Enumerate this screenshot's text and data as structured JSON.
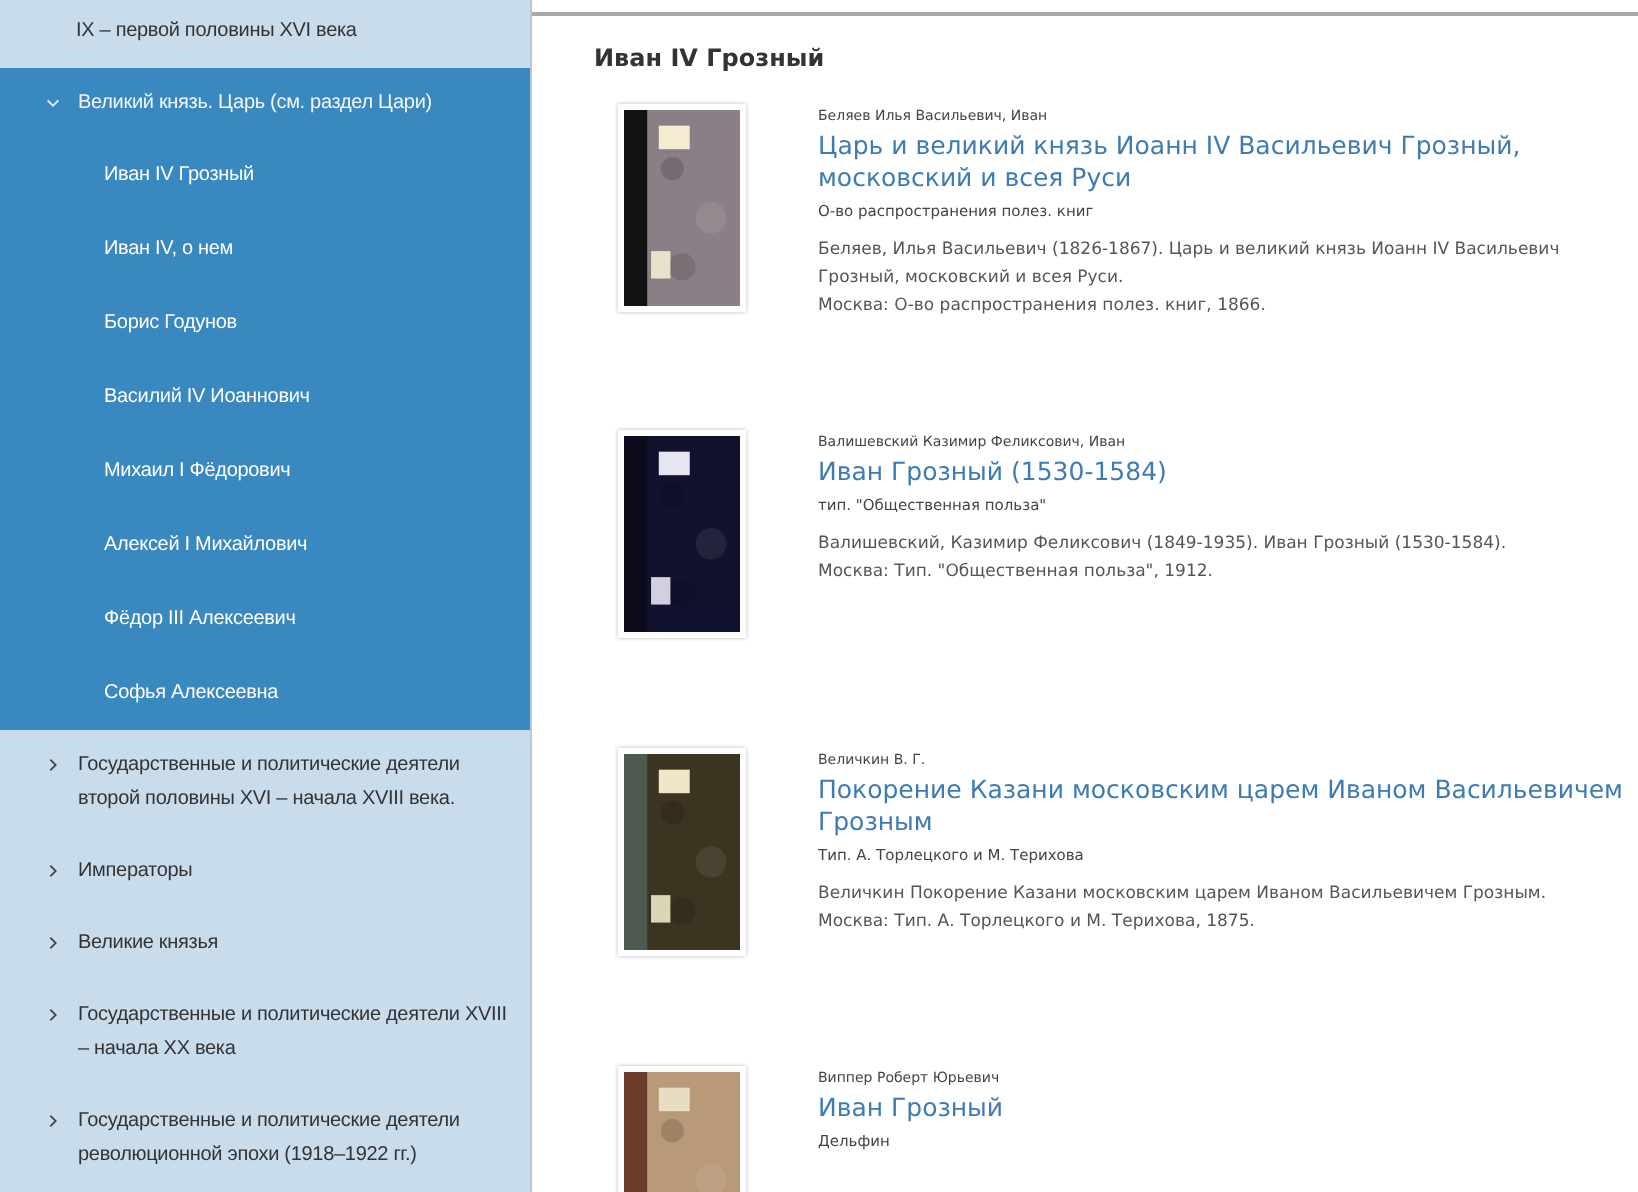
{
  "sidebar": {
    "items": [
      {
        "label": "IX – первой половины XVI века",
        "expanded": false,
        "has_chevron": false
      },
      {
        "label": "Великий князь. Царь (см. раздел Цари)",
        "expanded": true,
        "has_chevron": true,
        "children": [
          {
            "label": "Иван IV Грозный"
          },
          {
            "label": "Иван IV, о нем"
          },
          {
            "label": "Борис Годунов"
          },
          {
            "label": "Василий IV Иоаннович"
          },
          {
            "label": "Михаил I Фёдорович"
          },
          {
            "label": "Алексей I Михайлович"
          },
          {
            "label": "Фёдор III Алексеевич"
          },
          {
            "label": "Софья Алексеевна"
          }
        ]
      },
      {
        "label": "Государственные и политические деятели второй половины XVI – начала XVIII века.",
        "expanded": false,
        "has_chevron": true
      },
      {
        "label": "Императоры",
        "expanded": false,
        "has_chevron": true
      },
      {
        "label": "Великие князья",
        "expanded": false,
        "has_chevron": true
      },
      {
        "label": "Государственные и политические деятели XVIII – начала XX века",
        "expanded": false,
        "has_chevron": true
      },
      {
        "label": "Государственные и политические деятели революционной эпохи (1918–1922 гг.)",
        "expanded": false,
        "has_chevron": true
      }
    ]
  },
  "page_title": "Иван IV Грозный",
  "books": [
    {
      "author": "Беляев Илья Васильевич, Иван",
      "title": "Царь и великий князь Иоанн IV Васильевич Грозный, московский и всея Руси",
      "publisher": "О-во распространения полез. книг",
      "description": [
        "Беляев, Илья Васильевич (1826-1867). Царь и великий князь Иоанн IV Васильевич Грозный, московский и всея Руси.",
        "Москва: О-во распространения полез. книг, 1866."
      ]
    },
    {
      "author": "Валишевский Казимир Феликсович, Иван",
      "title": "Иван Грозный (1530-1584)",
      "publisher": "тип. \"Общественная польза\"",
      "description": [
        "Валишевский, Казимир Феликсович (1849-1935). Иван Грозный (1530-1584).",
        "Москва: Тип. \"Общественная польза\", 1912."
      ]
    },
    {
      "author": "Величкин В. Г.",
      "title": "Покорение Казани московским царем Иваном Васильевичем Грозным",
      "publisher": "Тип. А. Торлецкого и М. Терихова",
      "description": [
        "Величкин Покорение Казани московским царем Иваном Васильевичем Грозным.",
        "Москва: Тип. А. Торлецкого и М. Терихова, 1875."
      ]
    },
    {
      "author": "Виппер Роберт Юрьевич",
      "title": "Иван Грозный",
      "publisher": "Дельфин"
    }
  ]
}
